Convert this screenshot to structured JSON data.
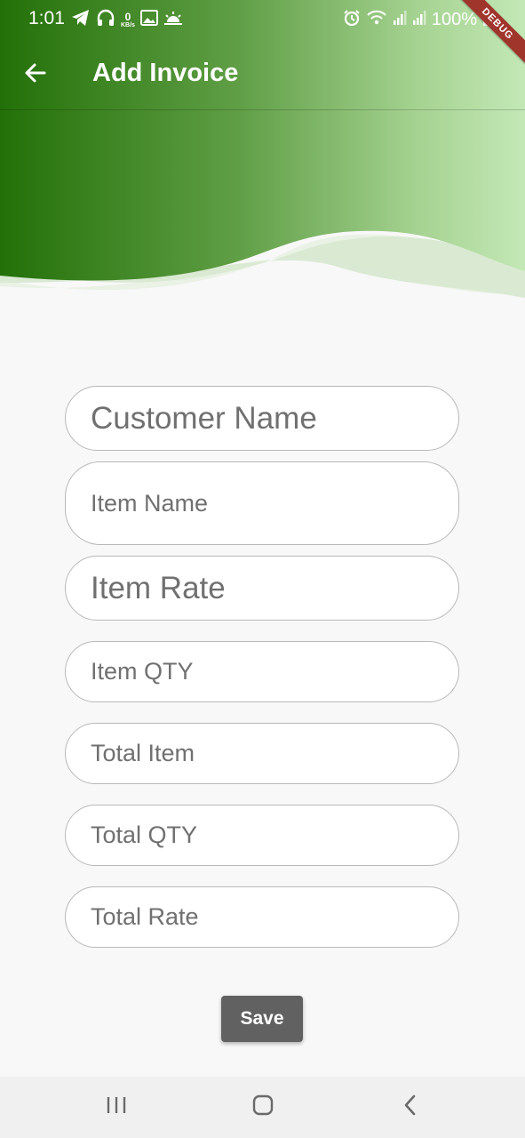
{
  "status_bar": {
    "time": "1:01",
    "net_speed_value": "0",
    "net_speed_unit": "KB/s",
    "battery": "100%",
    "debug_label": "DEBUG"
  },
  "app_bar": {
    "title": "Add Invoice"
  },
  "form": {
    "customer_name_placeholder": "Customer Name",
    "item_name_placeholder": "Item Name",
    "item_rate_placeholder": "Item Rate",
    "item_qty_placeholder": "Item QTY",
    "total_item_placeholder": "Total Item",
    "total_qty_placeholder": "Total QTY",
    "total_rate_placeholder": "Total Rate",
    "save_label": "Save"
  },
  "colors": {
    "header_dark_green": "#237008",
    "header_light_green": "#c3e8b6",
    "save_button": "#616161",
    "background": "#f8f8f8"
  },
  "icons": {
    "back": "arrow-left-icon",
    "nav_recents": "recents-icon",
    "nav_home": "home-icon",
    "nav_back": "nav-back-icon"
  }
}
